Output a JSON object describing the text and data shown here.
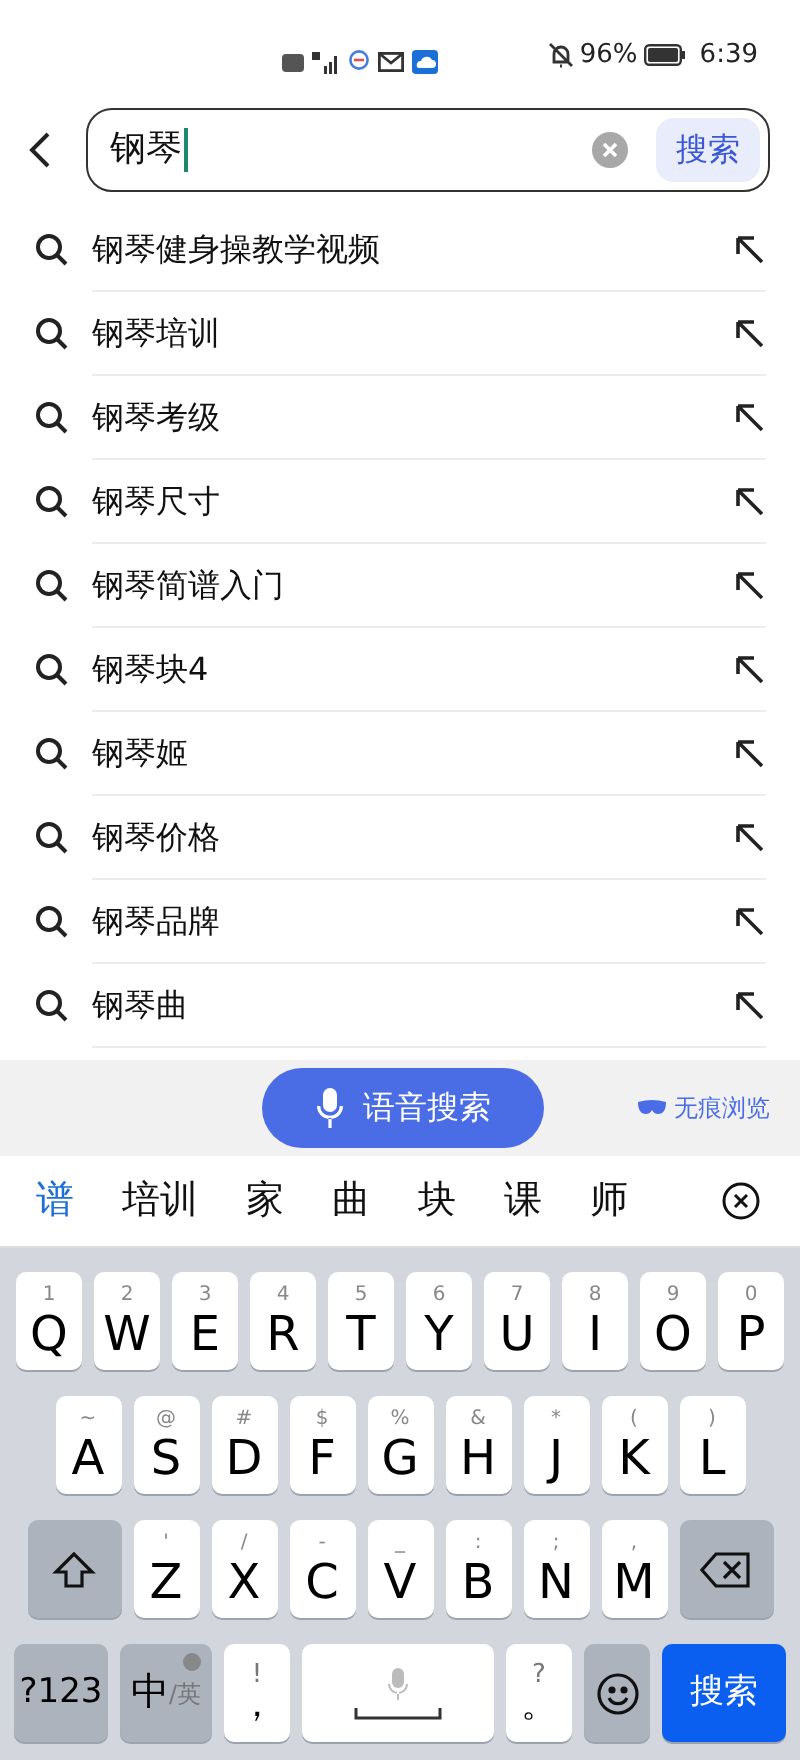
{
  "status_bar": {
    "battery_text": "96%",
    "time": "6:39"
  },
  "search": {
    "value": "钢琴",
    "button": "搜索"
  },
  "suggestions": [
    {
      "text": "钢琴健身操教学视频"
    },
    {
      "text": "钢琴培训"
    },
    {
      "text": "钢琴考级"
    },
    {
      "text": "钢琴尺寸"
    },
    {
      "text": "钢琴简谱入门"
    },
    {
      "text": "钢琴块4"
    },
    {
      "text": "钢琴姬"
    },
    {
      "text": "钢琴价格"
    },
    {
      "text": "钢琴品牌"
    },
    {
      "text": "钢琴曲"
    }
  ],
  "voice_button": "语音搜索",
  "incognito": "无痕浏览",
  "candidates": [
    {
      "text": "谱",
      "selected": true
    },
    {
      "text": "培训",
      "selected": false
    },
    {
      "text": "家",
      "selected": false
    },
    {
      "text": "曲",
      "selected": false
    },
    {
      "text": "块",
      "selected": false
    },
    {
      "text": "课",
      "selected": false
    },
    {
      "text": "师",
      "selected": false
    }
  ],
  "keyboard": {
    "letter_rows": [
      [
        {
          "kind": "letter",
          "main": "Q",
          "sub": "1"
        },
        {
          "kind": "letter",
          "main": "W",
          "sub": "2"
        },
        {
          "kind": "letter",
          "main": "E",
          "sub": "3"
        },
        {
          "kind": "letter",
          "main": "R",
          "sub": "4"
        },
        {
          "kind": "letter",
          "main": "T",
          "sub": "5"
        },
        {
          "kind": "letter",
          "main": "Y",
          "sub": "6"
        },
        {
          "kind": "letter",
          "main": "U",
          "sub": "7"
        },
        {
          "kind": "letter",
          "main": "I",
          "sub": "8"
        },
        {
          "kind": "letter",
          "main": "O",
          "sub": "9"
        },
        {
          "kind": "letter",
          "main": "P",
          "sub": "0"
        }
      ],
      [
        {
          "kind": "letter",
          "main": "A",
          "sub": "~"
        },
        {
          "kind": "letter",
          "main": "S",
          "sub": "@"
        },
        {
          "kind": "letter",
          "main": "D",
          "sub": "#"
        },
        {
          "kind": "letter",
          "main": "F",
          "sub": "$"
        },
        {
          "kind": "letter",
          "main": "G",
          "sub": "%"
        },
        {
          "kind": "letter",
          "main": "H",
          "sub": "&"
        },
        {
          "kind": "letter",
          "main": "J",
          "sub": "*"
        },
        {
          "kind": "letter",
          "main": "K",
          "sub": "("
        },
        {
          "kind": "letter",
          "main": "L",
          "sub": ")"
        }
      ],
      [
        {
          "kind": "shift"
        },
        {
          "kind": "letter",
          "main": "Z",
          "sub": "'"
        },
        {
          "kind": "letter",
          "main": "X",
          "sub": "/"
        },
        {
          "kind": "letter",
          "main": "C",
          "sub": "-"
        },
        {
          "kind": "letter",
          "main": "V",
          "sub": "_"
        },
        {
          "kind": "letter",
          "main": "B",
          "sub": ":"
        },
        {
          "kind": "letter",
          "main": "N",
          "sub": ";"
        },
        {
          "kind": "letter",
          "main": "M",
          "sub": ","
        },
        {
          "kind": "delete"
        }
      ]
    ],
    "bottom_bar": [
      {
        "kind": "symbols",
        "main": "?123"
      },
      {
        "kind": "lang",
        "main": "中",
        "sub": "/英"
      },
      {
        "kind": "punct",
        "main": "，",
        "sub": "!"
      },
      {
        "kind": "space"
      },
      {
        "kind": "punct",
        "main": "。",
        "sub": "?"
      },
      {
        "kind": "emoji"
      },
      {
        "kind": "enter",
        "main": "搜索"
      }
    ]
  }
}
